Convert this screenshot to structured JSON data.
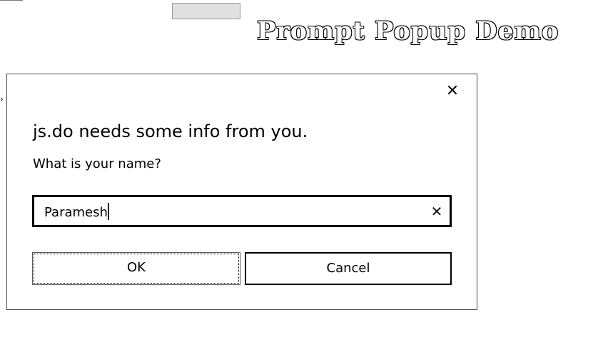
{
  "page": {
    "heading": "Prompt Popup Demo",
    "left_marker": "›"
  },
  "dialog": {
    "close_glyph": "✕",
    "heading": "js.do needs some info from you.",
    "prompt": "What is your name?",
    "input_value": "Paramesh",
    "clear_glyph": "✕",
    "ok_label": "OK",
    "cancel_label": "Cancel"
  },
  "icons": {
    "close": "close-icon",
    "clear": "clear-icon"
  }
}
